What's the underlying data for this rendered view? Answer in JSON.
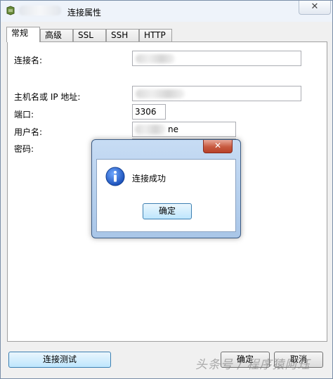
{
  "window": {
    "title": "连接属性",
    "close_glyph": "✕"
  },
  "tabs": [
    {
      "label": "常规",
      "active": true
    },
    {
      "label": "高级",
      "active": false
    },
    {
      "label": "SSL",
      "active": false
    },
    {
      "label": "SSH",
      "active": false
    },
    {
      "label": "HTTP",
      "active": false
    }
  ],
  "form": {
    "connection_name_label": "连接名:",
    "host_label": "主机名或 IP 地址:",
    "port_label": "端口:",
    "port_value": "3306",
    "username_label": "用户名:",
    "username_visible_suffix": "ne",
    "password_label": "密码:"
  },
  "dialog": {
    "close_glyph": "✕",
    "icon": "info-icon",
    "message": "连接成功",
    "ok_label": "确定"
  },
  "buttons": {
    "test_connection": "连接测试",
    "ok": "确定",
    "cancel": "取消"
  },
  "watermark": "头条号 / 程序猿阿珏"
}
